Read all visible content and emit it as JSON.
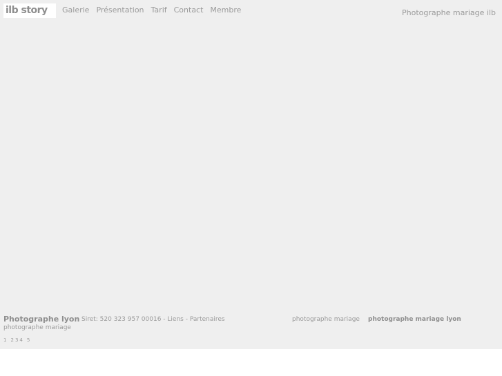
{
  "header": {
    "logo_text": "ilb story",
    "nav": [
      "Galerie",
      "Présentation",
      "Tarif",
      "Contact",
      "Membre"
    ],
    "tagline": "Photographe mariage ilb"
  },
  "footer": {
    "title": "Photographe lyon",
    "subtitle": "photographe mariage",
    "siret": "Siret: 520 323 957 00016",
    "sep1": " - ",
    "link_liens": "Liens",
    "sep2": " - ",
    "link_partenaires": "Partenaires",
    "link_mariage": "photographe mariage",
    "link_mariage_lyon": "photographe mariage lyon",
    "pages": [
      "1",
      "2",
      "3",
      "4",
      "5"
    ]
  },
  "colors": {
    "background": "#efefef",
    "text": "#9a9a9a",
    "text_bold": "#8e8e8e"
  }
}
